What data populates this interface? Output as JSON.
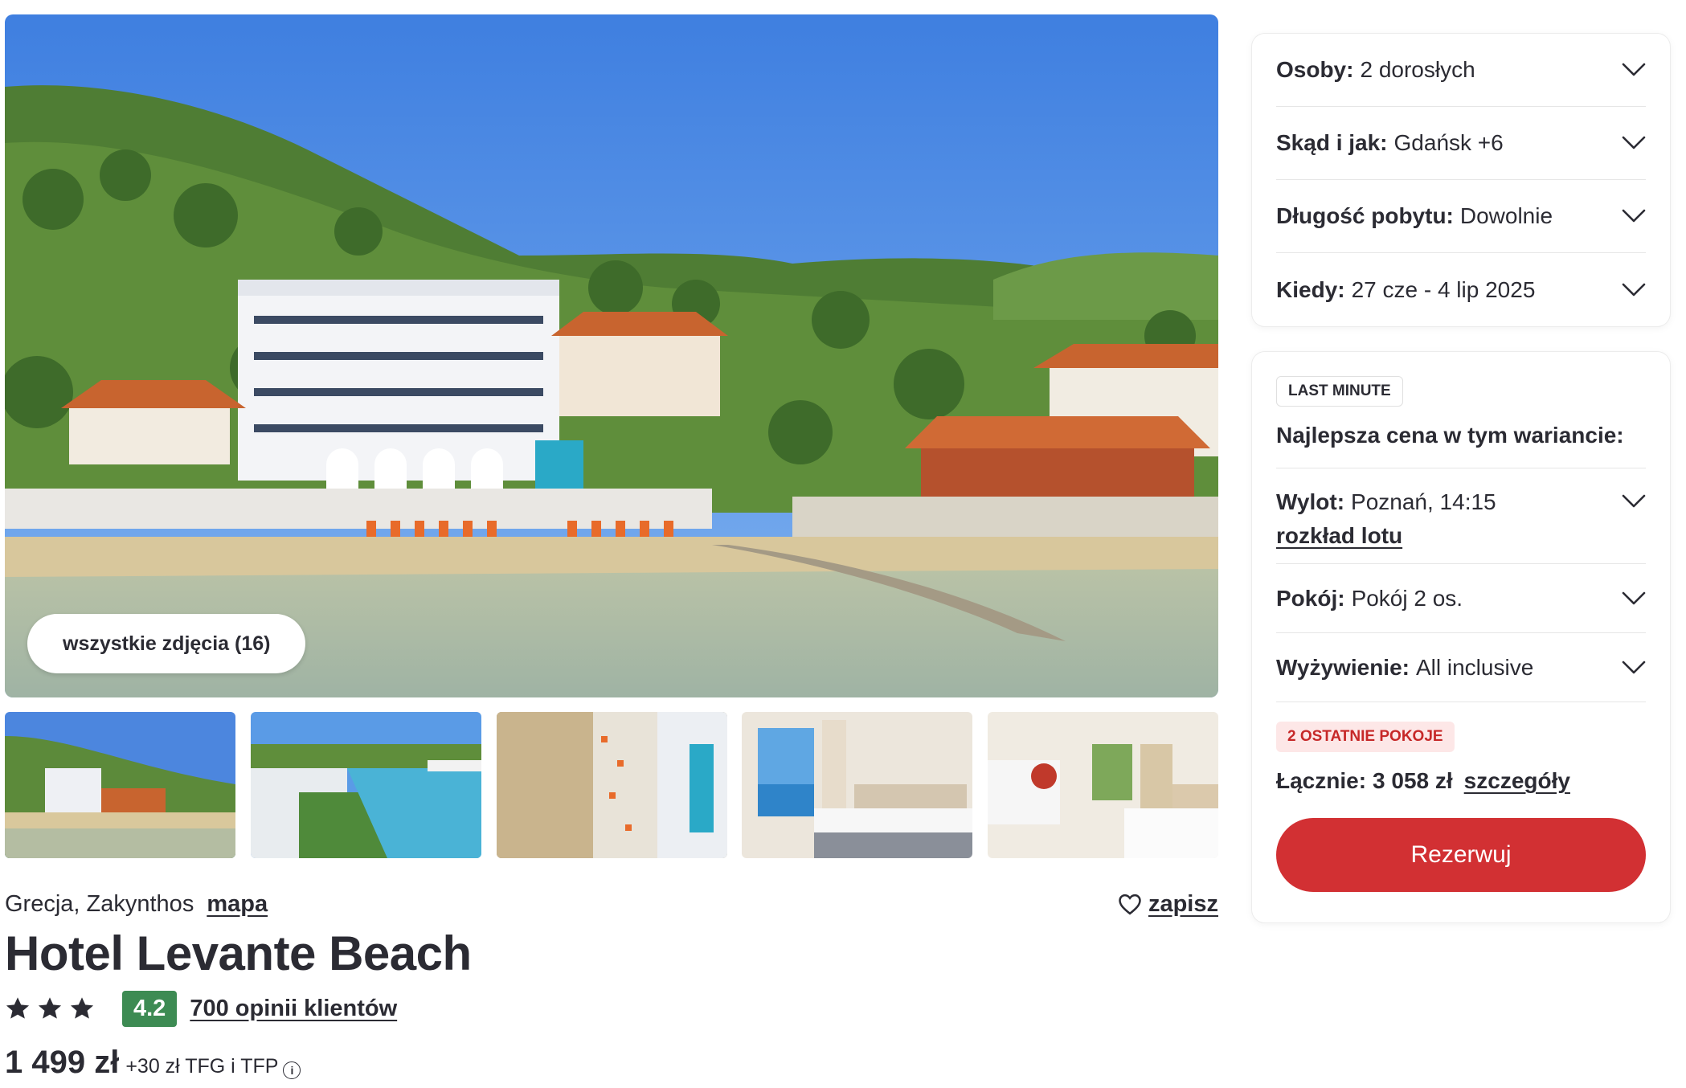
{
  "gallery": {
    "all_photos_label": "wszystkie zdjęcia (16)",
    "thumbnails": [
      "hotel-beach-view",
      "coastline-view",
      "aerial-beach-view",
      "bedroom-sea-view",
      "bedroom-interior"
    ]
  },
  "hotel": {
    "location": "Grecja, Zakynthos",
    "map_label": "mapa",
    "save_label": "zapisz",
    "name": "Hotel Levante Beach",
    "stars": 3,
    "score": "4.2",
    "reviews_label": "700 opinii klientów",
    "price": "1 499 zł",
    "fees": "+30 zł TFG i TFP",
    "info_icon": "i"
  },
  "filters": [
    {
      "key": "Osoby:",
      "value": "2 dorosłych"
    },
    {
      "key": "Skąd i jak:",
      "value": "Gdańsk +6"
    },
    {
      "key": "Długość pobytu:",
      "value": "Dowolnie"
    },
    {
      "key": "Kiedy:",
      "value": "27 cze - 4 lip 2025"
    }
  ],
  "offer": {
    "badge": "LAST MINUTE",
    "best_price_label": "Najlepsza cena w tym wariancie:",
    "flight_key": "Wylot:",
    "flight_value": "Poznań, 14:15",
    "schedule_label": "rozkład lotu",
    "room_key": "Pokój:",
    "room_value": "Pokój 2 os.",
    "board_key": "Wyżywienie:",
    "board_value": "All inclusive",
    "rooms_badge": "2 OSTATNIE POKOJE",
    "total_label": "Łącznie:",
    "total_value": "3 058 zł",
    "details_label": "szczegóły",
    "book_label": "Rezerwuj"
  },
  "colors": {
    "accent": "#d23033",
    "score_badge": "#3d8b53",
    "rooms_badge_bg": "#fde7e7",
    "rooms_badge_text": "#c62828",
    "text": "#2b2b33"
  }
}
